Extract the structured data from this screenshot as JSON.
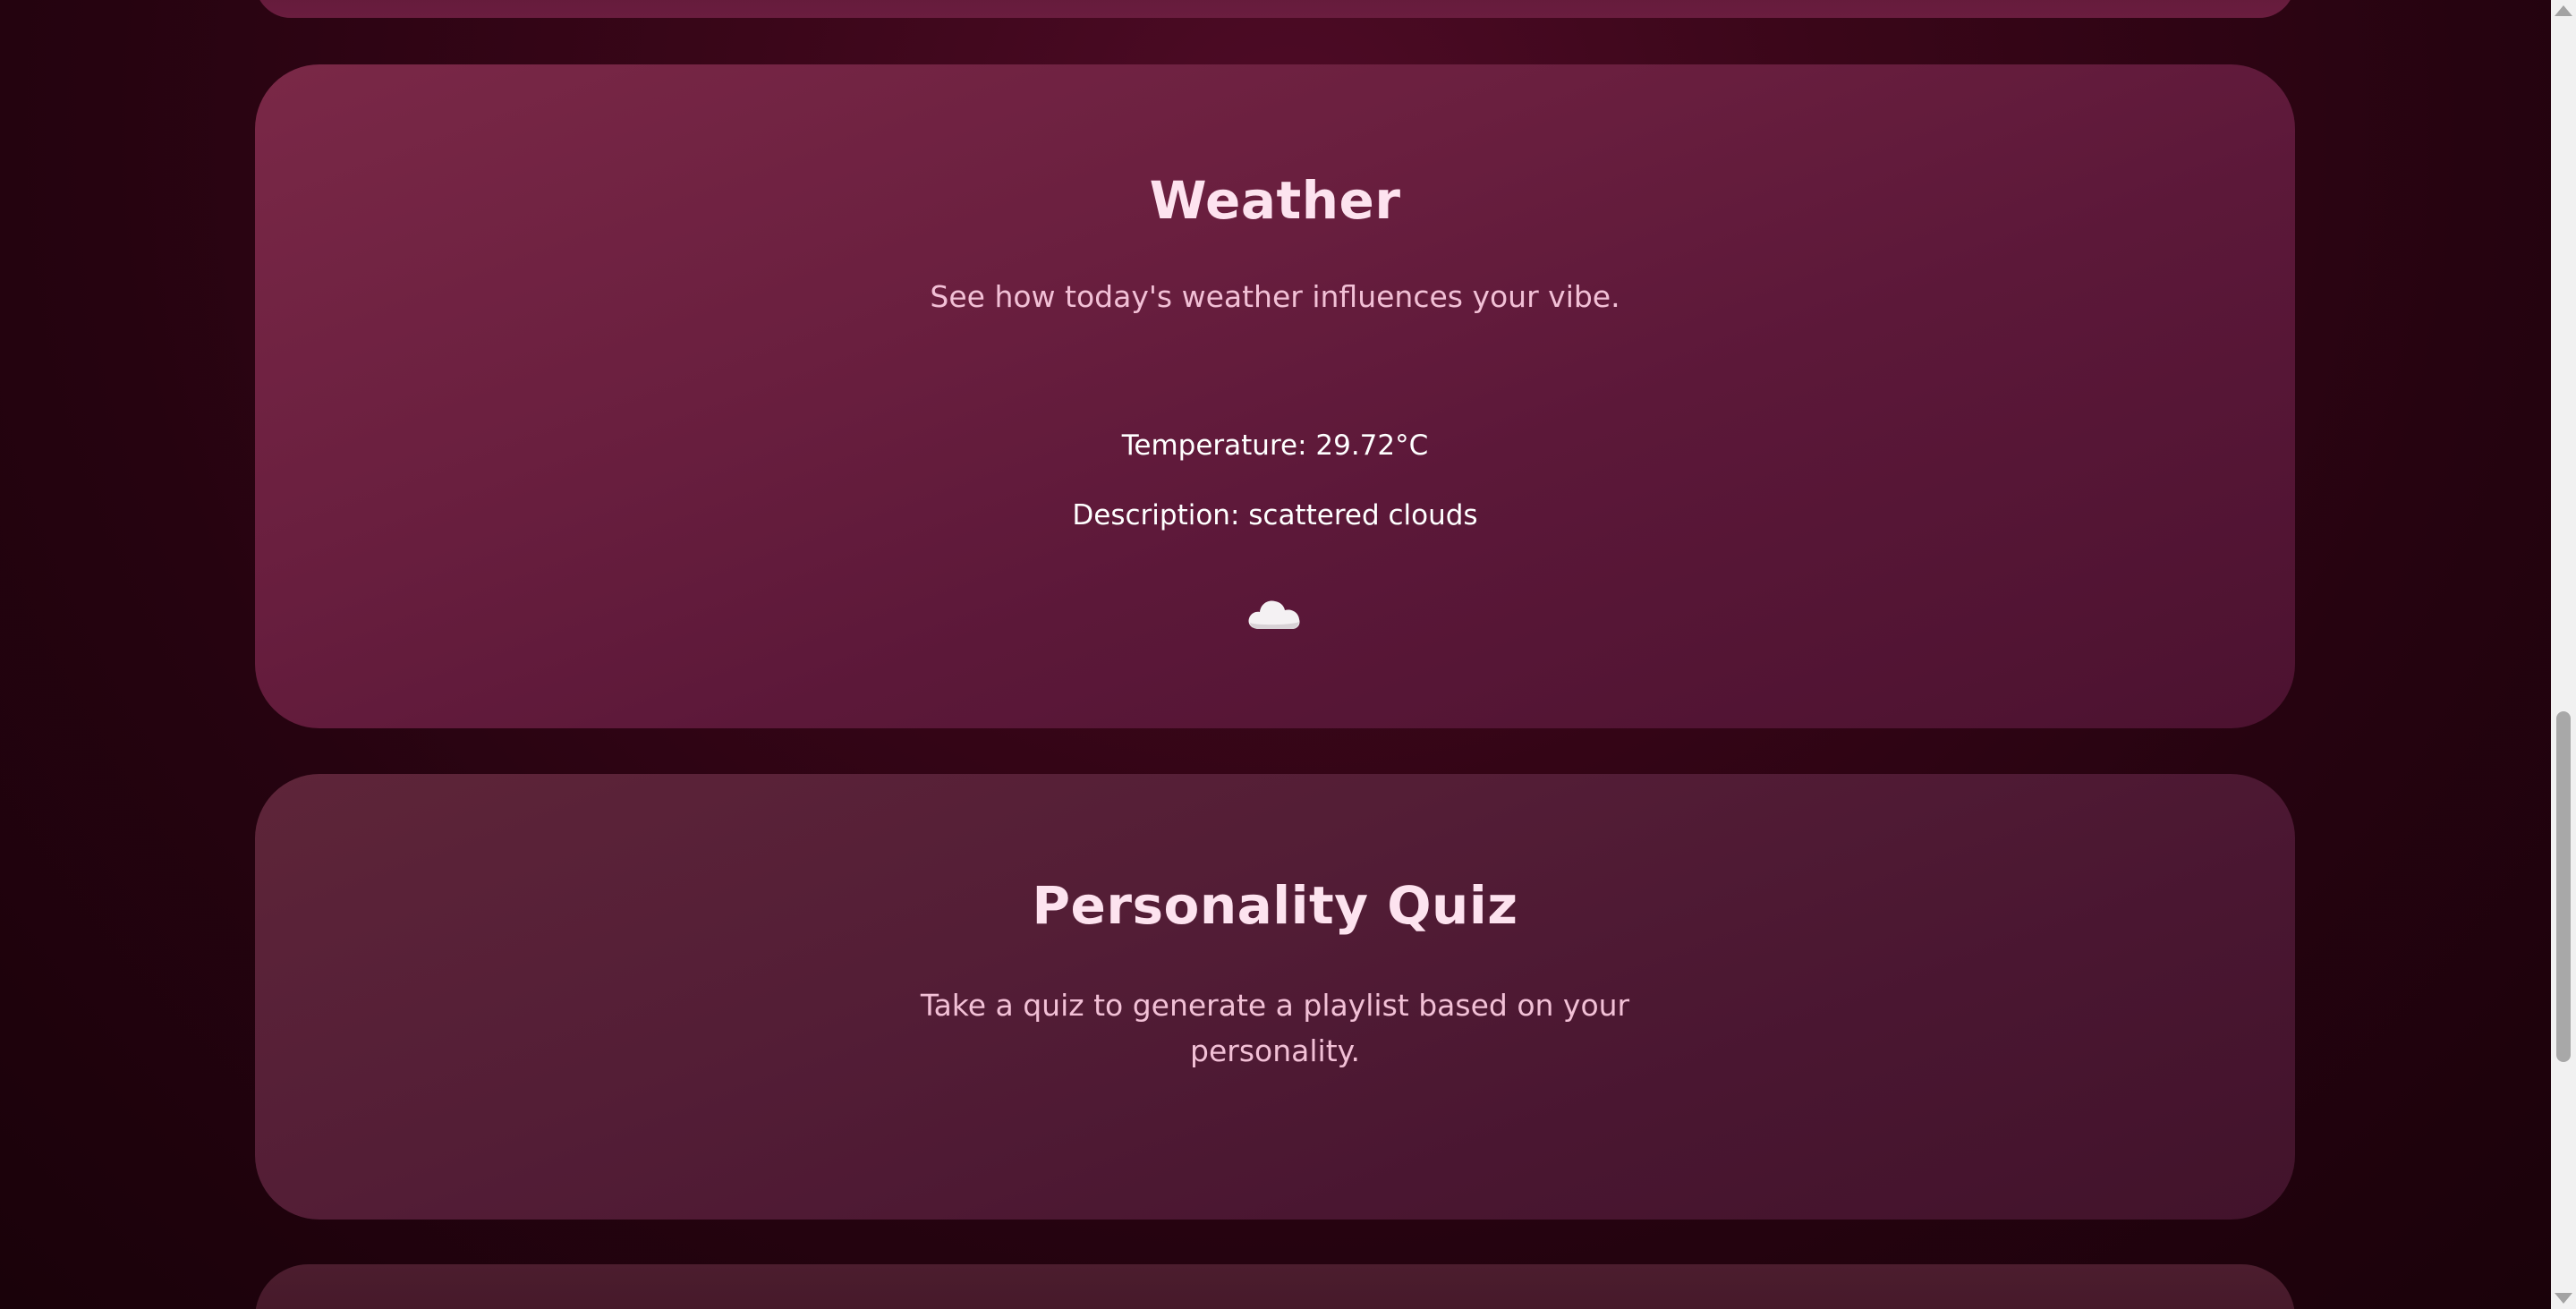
{
  "weather": {
    "title": "Weather",
    "subtitle": "See how today's weather influences your vibe.",
    "temperature_line": "Temperature: 29.72°C",
    "description_line": "Description: scattered clouds",
    "icon": "cloud-icon"
  },
  "quiz": {
    "title": "Personality Quiz",
    "subtitle_line1": "Take a quiz to generate a playlist based on your",
    "subtitle_line2": "personality."
  },
  "colors": {
    "background": "#3a0619",
    "card": "#6a1f3f",
    "title_text": "#fde3ef",
    "subtitle_text": "#f2c0d6"
  }
}
